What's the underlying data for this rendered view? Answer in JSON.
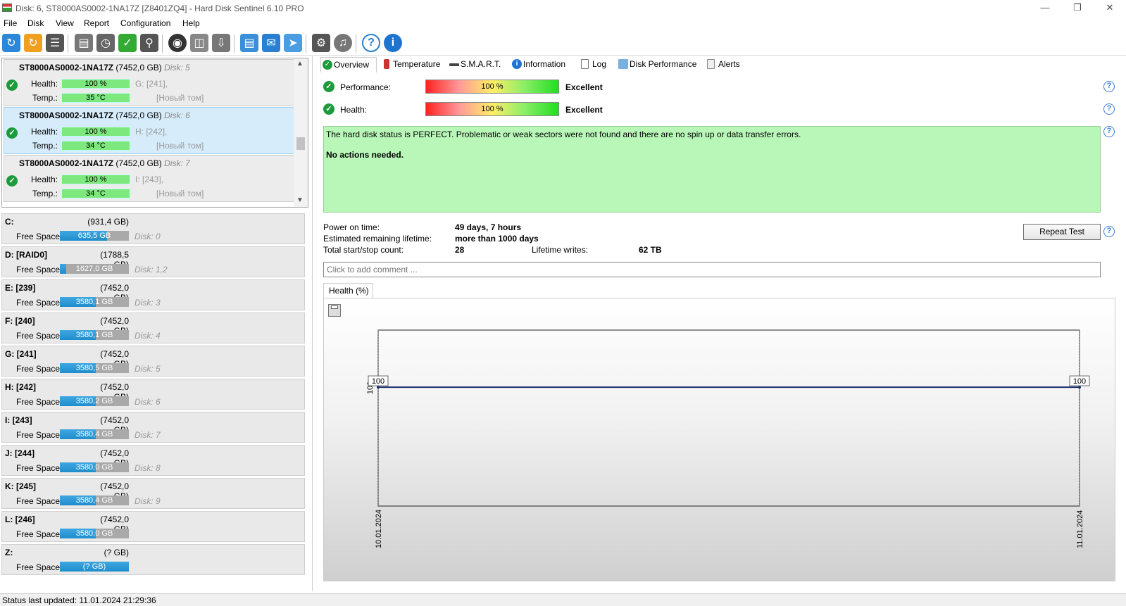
{
  "window": {
    "title": "Disk: 6, ST8000AS0002-1NA17Z [Z8401ZQ4]  -  Hard Disk Sentinel 6.10 PRO"
  },
  "menu": [
    "File",
    "Disk",
    "View",
    "Report",
    "Configuration",
    "Help"
  ],
  "toolbar_icons": [
    "refresh-icon",
    "refresh-all-icon",
    "disk-list-icon",
    "hdd-icon",
    "hdd-schedule-icon",
    "hdd-check-icon",
    "hdd-search-icon",
    "globe-icon",
    "network-icon",
    "backup-icon",
    "report-icon",
    "email-icon",
    "send-icon",
    "settings-icon",
    "sound-icon",
    "help-icon",
    "info-icon"
  ],
  "disks": [
    {
      "model": "ST8000AS0002-1NA17Z",
      "size": "(7452,0 GB)",
      "disk": "Disk: 5",
      "health_label": "Health:",
      "health": "100 %",
      "health_pct": 100,
      "health_part": "G: [241],",
      "temp_label": "Temp.:",
      "temp": "35 °C",
      "temp_part": "[Новый том]"
    },
    {
      "model": "ST8000AS0002-1NA17Z",
      "size": "(7452,0 GB)",
      "disk": "Disk: 6",
      "health_label": "Health:",
      "health": "100 %",
      "health_pct": 100,
      "health_part": "H: [242],",
      "temp_label": "Temp.:",
      "temp": "34 °C",
      "temp_part": "[Новый том]"
    },
    {
      "model": "ST8000AS0002-1NA17Z",
      "size": "(7452,0 GB)",
      "disk": "Disk: 7",
      "health_label": "Health:",
      "health": "100 %",
      "health_pct": 100,
      "health_part": "I: [243],",
      "temp_label": "Temp.:",
      "temp": "34 °C",
      "temp_part": "[Новый том]"
    }
  ],
  "volumes": [
    {
      "name": "C:",
      "size": "(931,4 GB)",
      "free_label": "Free Space",
      "free": "635,5 GB",
      "used_frac": 0.68,
      "disk": "Disk: 0"
    },
    {
      "name": "D: [RAID0]",
      "size": "(1788,5 GB)",
      "free_label": "Free Space",
      "free": "1627,0 GB",
      "used_frac": 0.09,
      "disk": "Disk: 1,2"
    },
    {
      "name": "E: [239]",
      "size": "(7452,0 GB)",
      "free_label": "Free Space",
      "free": "3580,1 GB",
      "used_frac": 0.52,
      "disk": "Disk: 3"
    },
    {
      "name": "F: [240]",
      "size": "(7452,0 GB)",
      "free_label": "Free Space",
      "free": "3580,1 GB",
      "used_frac": 0.52,
      "disk": "Disk: 4"
    },
    {
      "name": "G: [241]",
      "size": "(7452,0 GB)",
      "free_label": "Free Space",
      "free": "3580,5 GB",
      "used_frac": 0.52,
      "disk": "Disk: 5"
    },
    {
      "name": "H: [242]",
      "size": "(7452,0 GB)",
      "free_label": "Free Space",
      "free": "3580,2 GB",
      "used_frac": 0.52,
      "disk": "Disk: 6"
    },
    {
      "name": "I: [243]",
      "size": "(7452,0 GB)",
      "free_label": "Free Space",
      "free": "3580,4 GB",
      "used_frac": 0.52,
      "disk": "Disk: 7"
    },
    {
      "name": "J: [244]",
      "size": "(7452,0 GB)",
      "free_label": "Free Space",
      "free": "3580,0 GB",
      "used_frac": 0.52,
      "disk": "Disk: 8"
    },
    {
      "name": "K: [245]",
      "size": "(7452,0 GB)",
      "free_label": "Free Space",
      "free": "3580,4 GB",
      "used_frac": 0.52,
      "disk": "Disk: 9"
    },
    {
      "name": "L: [246]",
      "size": "(7452,0 GB)",
      "free_label": "Free Space",
      "free": "3580,0 GB",
      "used_frac": 0.52,
      "disk": ""
    },
    {
      "name": "Z:",
      "size": "(? GB)",
      "free_label": "Free Space",
      "free": "(? GB)",
      "used_frac": 1.0,
      "disk": ""
    }
  ],
  "tabs": [
    "Overview",
    "Temperature",
    "S.M.A.R.T.",
    "Information",
    "Log",
    "Disk Performance",
    "Alerts"
  ],
  "overview": {
    "performance_label": "Performance:",
    "performance_value": "100 %",
    "performance_text": "Excellent",
    "health_label": "Health:",
    "health_value": "100 %",
    "health_text": "Excellent",
    "status_text": "The hard disk status is PERFECT. Problematic or weak sectors were not found and there are no spin up or data transfer errors.",
    "actions_text": "No actions needed.",
    "power_on_label": "Power on time:",
    "power_on_value": "49 days, 7 hours",
    "lifetime_label": "Estimated remaining lifetime:",
    "lifetime_value": "more than 1000 days",
    "startstop_label": "Total start/stop count:",
    "startstop_value": "28",
    "writes_label": "Lifetime writes:",
    "writes_value": "62 TB",
    "repeat_button": "Repeat Test",
    "comment_placeholder": "Click to add comment ..."
  },
  "chart_tab": "Health (%)",
  "chart_data": {
    "type": "line",
    "x": [
      "10.01.2024",
      "11.01.2024"
    ],
    "series": [
      {
        "values": [
          100,
          100
        ]
      }
    ],
    "data_labels": [
      "100",
      "100"
    ],
    "ytick": "100"
  },
  "statusbar": {
    "text": "Status last updated: 11.01.2024 21:29:36"
  }
}
